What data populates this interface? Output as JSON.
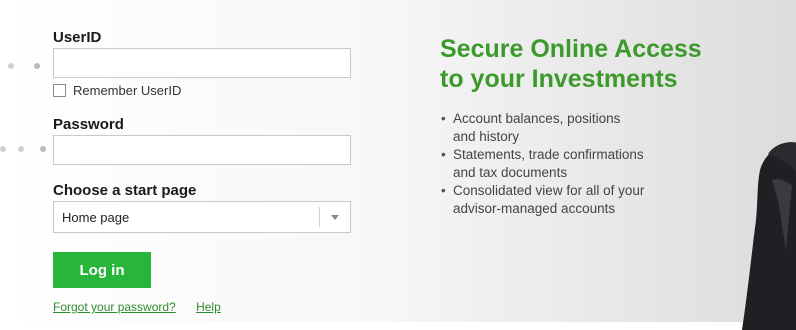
{
  "login": {
    "userid_label": "UserID",
    "remember_label": "Remember UserID",
    "password_label": "Password",
    "start_page_label": "Choose a start page",
    "start_page_value": "Home page",
    "login_button": "Log in",
    "forgot_link": "Forgot your password?",
    "help_link": "Help"
  },
  "promo": {
    "headline_line1": "Secure Online Access",
    "headline_line2": "to your Investments",
    "bullets": [
      "Account balances, positions",
      "and history",
      "Statements, trade confirmations",
      "and tax documents",
      "Consolidated view for all of your",
      "advisor-managed accounts"
    ]
  },
  "colors": {
    "accent_green": "#3c9a2c",
    "button_green": "#27b53a",
    "link_green": "#2e8a2e"
  }
}
